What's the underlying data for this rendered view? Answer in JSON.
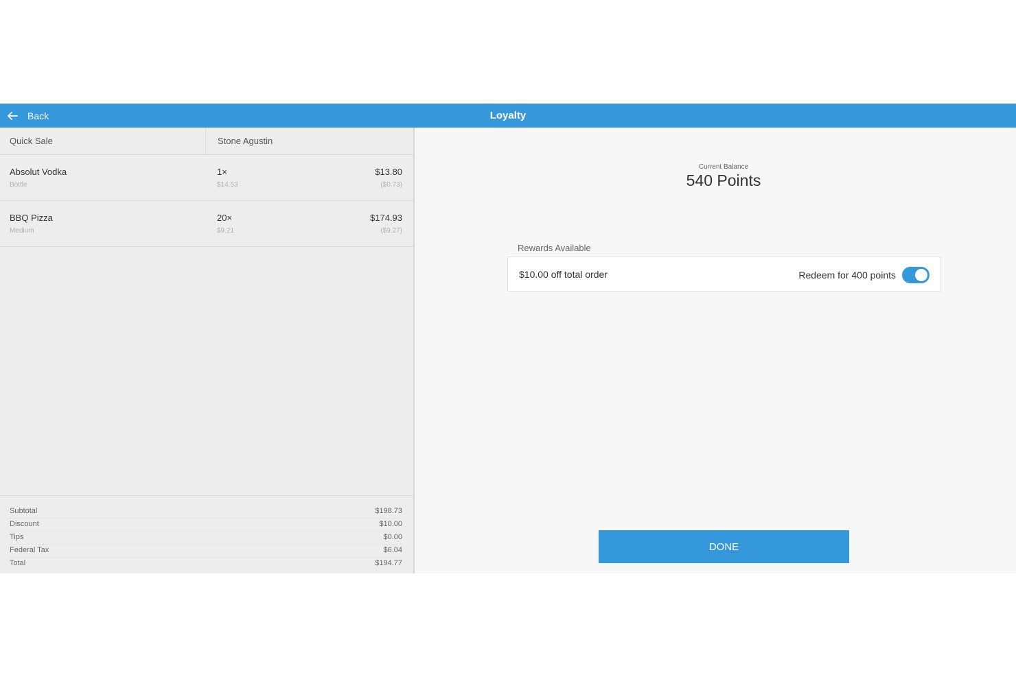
{
  "header": {
    "back_label": "Back",
    "title": "Loyalty"
  },
  "order": {
    "columns": [
      "Quick Sale",
      "Stone Agustin"
    ],
    "items": [
      {
        "name": "Absolut Vodka",
        "variant": "Bottle",
        "qty": "1×",
        "unit_price": "$14.53",
        "price": "$13.80",
        "discount": "($0.73)"
      },
      {
        "name": "BBQ Pizza",
        "variant": "Medium",
        "qty": "20×",
        "unit_price": "$9.21",
        "price": "$174.93",
        "discount": "($9.27)"
      }
    ],
    "totals": [
      {
        "label": "Subtotal",
        "value": "$198.73"
      },
      {
        "label": "Discount",
        "value": "$10.00"
      },
      {
        "label": "Tips",
        "value": "$0.00"
      },
      {
        "label": "Federal Tax",
        "value": "$6.04"
      },
      {
        "label": "Total",
        "value": "$194.77"
      }
    ]
  },
  "loyalty": {
    "balance_label": "Current Balance",
    "balance_value": "540 Points",
    "rewards_label": "Rewards Available",
    "reward": {
      "description": "$10.00 off total order",
      "redeem_label": "Redeem for 400 points",
      "toggle_on": true
    },
    "done_label": "DONE"
  },
  "colors": {
    "accent": "#3498db"
  },
  "icons": {
    "back": "arrow-left-icon"
  }
}
